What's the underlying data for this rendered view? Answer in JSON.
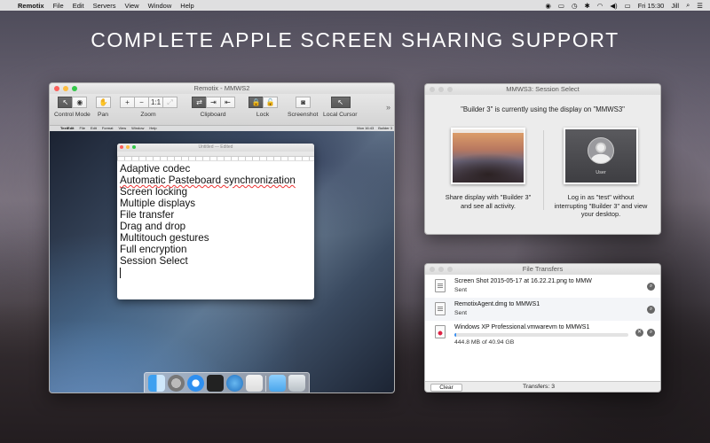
{
  "menubar": {
    "apple": "",
    "app": "Remotix",
    "items": [
      "File",
      "Edit",
      "Servers",
      "View",
      "Window",
      "Help"
    ],
    "clock": "Fri 15:30",
    "user": "Jill"
  },
  "headline": "COMPLETE APPLE SCREEN SHARING SUPPORT",
  "remotix": {
    "title": "Remotix - MMWS2",
    "toolbar": {
      "control_mode": "Control Mode",
      "pan": "Pan",
      "zoom": "Zoom",
      "zoom_minus": "−",
      "zoom_plus": "+",
      "zoom_actual": "1:1",
      "clipboard": "Clipboard",
      "lock": "Lock",
      "screenshot": "Screenshot",
      "local_cursor": "Local Cursor",
      "more": "»"
    },
    "remote": {
      "menubar": [
        "TextEdit",
        "File",
        "Edit",
        "Format",
        "View",
        "Window",
        "Help"
      ],
      "clock": "Mon 16:43",
      "user": "Builder 3",
      "textedit": {
        "title": "Untitled — Edited",
        "lines": [
          "Adaptive codec",
          "Automatic Pasteboard synchronization",
          "Screen locking",
          "Multiple displays",
          "File transfer",
          "Drag and drop",
          "Multitouch gestures",
          "Full encryption",
          "Session Select"
        ]
      }
    }
  },
  "session": {
    "title": "MMWS3: Session Select",
    "message": "\"Builder 3\" is currently using the display on \"MMWS3\"",
    "share_text": "Share display with \"Builder 3\" and see all activity.",
    "login_text": "Log in as \"test\" without interrupting \"Builder 3\" and view your desktop.",
    "avatar_label": "User"
  },
  "transfers": {
    "title": "File Transfers",
    "items": [
      {
        "name": "Screen Shot 2015-05-17 at 16.22.21.png to MMW",
        "status": "Sent"
      },
      {
        "name": "RemotixAgent.dmg to MMWS1",
        "status": "Sent"
      },
      {
        "name": "Windows XP Professional.vmwarevm to MMWS1",
        "status": "444.8 MB of 40.94 GB",
        "progress": 0.011
      }
    ],
    "clear": "Clear",
    "count": "Transfers: 3"
  },
  "colors": {
    "accent": "#3b8ff0",
    "close": "#fc605c",
    "minimize": "#fdbc40",
    "zoom": "#34c84a"
  }
}
